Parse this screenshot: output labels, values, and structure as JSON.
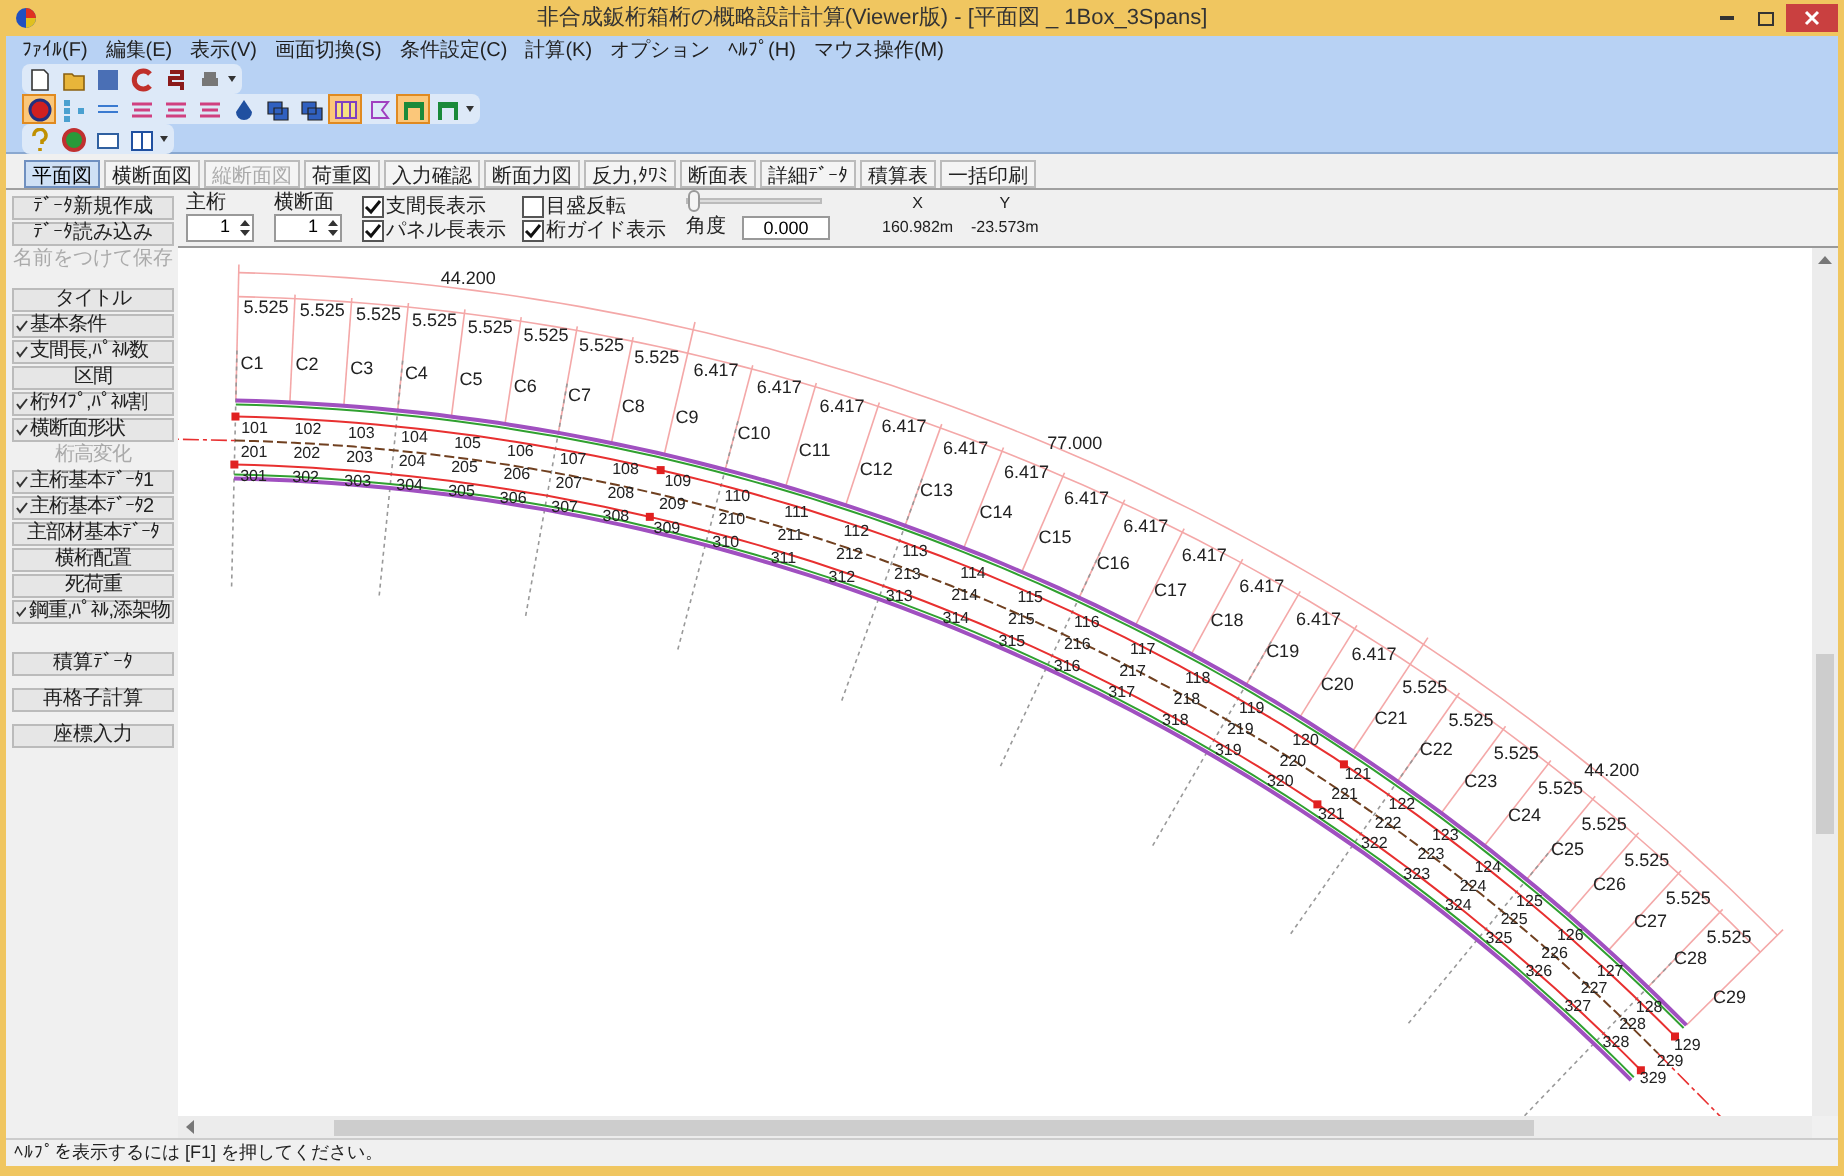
{
  "window": {
    "title": "非合成鈑桁箱桁の概略設計計算(Viewer版) - [平面図 _ 1Box_3Spans]"
  },
  "menu": [
    "ﾌｧｲﾙ(F)",
    "編集(E)",
    "表示(V)",
    "画面切換(S)",
    "条件設定(C)",
    "計算(K)",
    "オプション",
    "ﾍﾙﾌﾟ(H)",
    "マウス操作(M)"
  ],
  "toolbars": [
    [
      {
        "pressed": false
      },
      {
        "pressed": false
      },
      {
        "pressed": false
      },
      {
        "pressed": false
      },
      {
        "pressed": false
      },
      {
        "pressed": false
      }
    ],
    [
      {
        "pressed": true
      },
      {
        "pressed": false
      },
      {
        "pressed": false
      },
      {
        "pressed": false
      },
      {
        "pressed": false
      },
      {
        "pressed": false
      },
      {
        "pressed": false
      },
      {
        "pressed": false
      },
      {
        "pressed": false
      },
      {
        "pressed": true
      },
      {
        "pressed": false
      },
      {
        "pressed": true
      },
      {
        "pressed": false
      }
    ],
    [
      {
        "pressed": false
      },
      {
        "pressed": false
      },
      {
        "pressed": false
      },
      {
        "pressed": false
      }
    ]
  ],
  "tabs": [
    {
      "label": "平面図",
      "selected": true,
      "disabled": false
    },
    {
      "label": "横断面図",
      "selected": false,
      "disabled": false
    },
    {
      "label": "縦断面図",
      "selected": false,
      "disabled": true
    },
    {
      "label": "荷重図",
      "selected": false,
      "disabled": false
    },
    {
      "label": "入力確認",
      "selected": false,
      "disabled": false
    },
    {
      "label": "断面力図",
      "selected": false,
      "disabled": false
    },
    {
      "label": "反力,ﾀﾜﾐ",
      "selected": false,
      "disabled": false
    },
    {
      "label": "断面表",
      "selected": false,
      "disabled": false
    },
    {
      "label": "詳細ﾃﾞｰﾀ",
      "selected": false,
      "disabled": false
    },
    {
      "label": "積算表",
      "selected": false,
      "disabled": false
    },
    {
      "label": "一括印刷",
      "selected": false,
      "disabled": false
    }
  ],
  "controls": {
    "spinners": [
      {
        "label": "主桁",
        "value": "1"
      },
      {
        "label": "横断面",
        "value": "1"
      }
    ],
    "checkboxes": [
      {
        "label": "支間長表示",
        "checked": true
      },
      {
        "label": "パネル長表示",
        "checked": true
      },
      {
        "label": "目盛反転",
        "checked": false
      },
      {
        "label": "桁ガイド表示",
        "checked": true
      }
    ],
    "slider": {
      "level": 0
    },
    "angle": {
      "label": "角度",
      "value": "0.000"
    },
    "coordinates": {
      "x_label": "X",
      "y_label": "Y",
      "x": "160.982m",
      "y": "-23.573m"
    }
  },
  "sidebar": {
    "file_buttons": [
      {
        "label": "ﾃﾞｰﾀ新規作成",
        "disabled": false
      },
      {
        "label": "ﾃﾞｰﾀ読み込み",
        "disabled": false
      },
      {
        "label": "名前をつけて保存",
        "disabled": true
      }
    ],
    "items": [
      {
        "label": "タイトル",
        "done": false,
        "disabled": false
      },
      {
        "label": "基本条件",
        "done": true,
        "disabled": false
      },
      {
        "label": "支間長,ﾊﾟﾈﾙ数",
        "done": true,
        "disabled": false
      },
      {
        "label": "区間",
        "done": false,
        "disabled": false
      },
      {
        "label": "桁ﾀｲﾌﾟ,ﾊﾟﾈﾙ割",
        "done": true,
        "disabled": false
      },
      {
        "label": "横断面形状",
        "done": true,
        "disabled": false
      },
      {
        "label": "桁高変化",
        "done": false,
        "disabled": true
      },
      {
        "label": "主桁基本ﾃﾞｰﾀ1",
        "done": true,
        "disabled": false
      },
      {
        "label": "主桁基本ﾃﾞｰﾀ2",
        "done": true,
        "disabled": false
      },
      {
        "label": "主部材基本ﾃﾞｰﾀ",
        "done": false,
        "disabled": false
      },
      {
        "label": "横桁配置",
        "done": false,
        "disabled": false
      },
      {
        "label": "死荷重",
        "done": false,
        "disabled": false
      },
      {
        "label": "鋼重,ﾊﾟﾈﾙ,添架物",
        "done": true,
        "disabled": false
      }
    ],
    "extra_buttons": [
      "積算ﾃﾞｰﾀ",
      "再格子計算",
      "座標入力"
    ]
  },
  "drawing": {
    "total_lengths": [
      "44.200",
      "77.000",
      "44.200"
    ],
    "panel_lengths": [
      "5.525",
      "5.525",
      "5.525",
      "5.525",
      "5.525",
      "5.525",
      "5.525",
      "5.525",
      "6.417",
      "6.417",
      "6.417",
      "6.417",
      "6.417",
      "6.417",
      "6.417",
      "6.417",
      "6.417",
      "6.417",
      "6.417",
      "6.417",
      "5.525",
      "5.525",
      "5.525",
      "5.525",
      "5.525",
      "5.525",
      "5.525",
      "5.525"
    ],
    "cross_beams": [
      "C1",
      "C2",
      "C3",
      "C4",
      "C5",
      "C6",
      "C7",
      "C8",
      "C9",
      "C10",
      "C11",
      "C12",
      "C13",
      "C14",
      "C15",
      "C16",
      "C17",
      "C18",
      "C19",
      "C20",
      "C21",
      "C22",
      "C23",
      "C24",
      "C25",
      "C26",
      "C27",
      "C28",
      "C29"
    ],
    "node_rows": [
      [
        "101",
        "102",
        "103",
        "104",
        "105",
        "106",
        "107",
        "108",
        "109",
        "110",
        "111",
        "112",
        "113",
        "114",
        "115",
        "116",
        "117",
        "118",
        "119",
        "120",
        "121",
        "122",
        "123",
        "124",
        "125",
        "126",
        "127",
        "128",
        "129"
      ],
      [
        "201",
        "202",
        "203",
        "204",
        "205",
        "206",
        "207",
        "208",
        "209",
        "210",
        "211",
        "212",
        "213",
        "214",
        "215",
        "216",
        "217",
        "218",
        "219",
        "220",
        "221",
        "222",
        "223",
        "224",
        "225",
        "226",
        "227",
        "228",
        "229"
      ],
      [
        "301",
        "302",
        "303",
        "304",
        "305",
        "306",
        "307",
        "308",
        "309",
        "310",
        "311",
        "312",
        "313",
        "314",
        "315",
        "316",
        "317",
        "318",
        "319",
        "320",
        "321",
        "322",
        "323",
        "324",
        "325",
        "326",
        "327",
        "328",
        "329"
      ]
    ]
  },
  "status_bar": "ﾍﾙﾌﾟを表示するには [F1] を押してください。"
}
